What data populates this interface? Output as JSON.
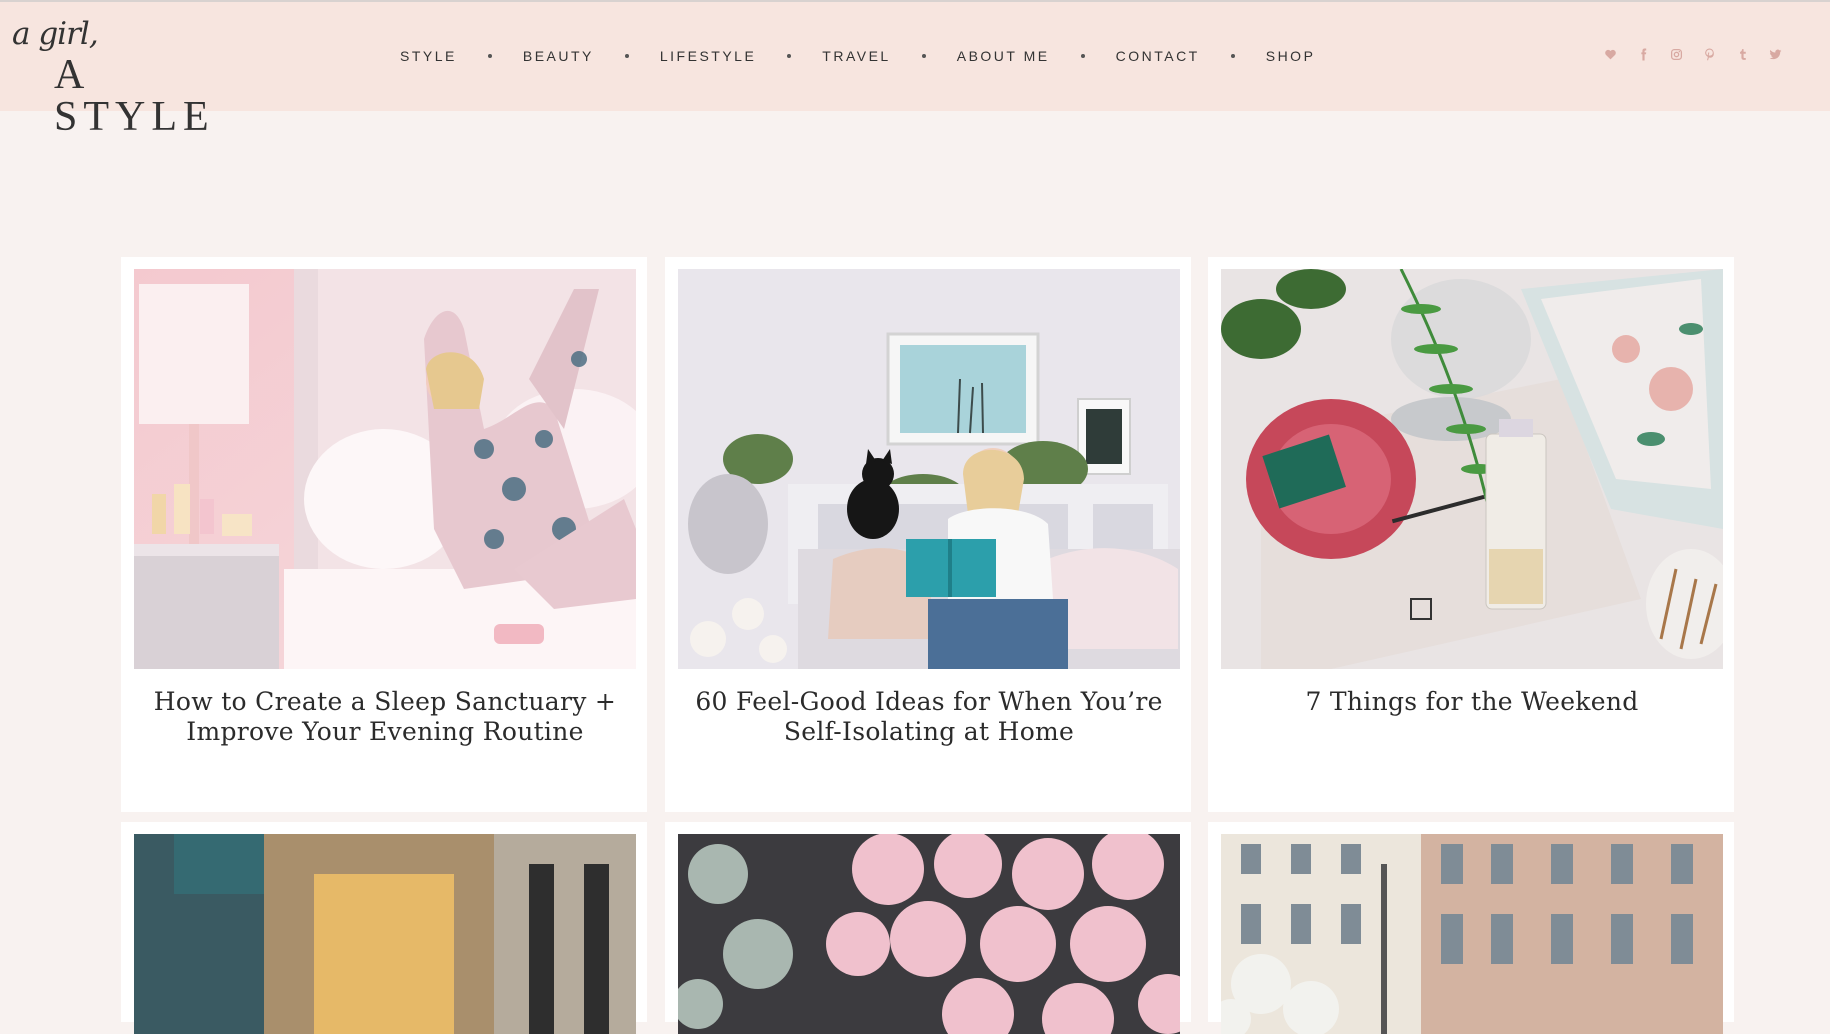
{
  "logo": {
    "script": "a girl,",
    "main": "A STYLE"
  },
  "nav": {
    "items": [
      "STYLE",
      "BEAUTY",
      "LIFESTYLE",
      "TRAVEL",
      "ABOUT ME",
      "CONTACT",
      "SHOP"
    ]
  },
  "social": {
    "icons": [
      "heart-icon",
      "facebook-icon",
      "instagram-icon",
      "pinterest-icon",
      "tumblr-icon",
      "twitter-icon"
    ]
  },
  "posts": [
    {
      "title": "How to Create a Sleep Sanctuary + Improve Your Evening Routine"
    },
    {
      "title": "60 Feel-Good Ideas for When You’re Self-Isolating at Home"
    },
    {
      "title": "7 Things for the Weekend"
    }
  ],
  "colors": {
    "header_bg": "#f7e5df",
    "page_bg": "#f8f2f0",
    "social_icon": "#d8a9a2"
  }
}
